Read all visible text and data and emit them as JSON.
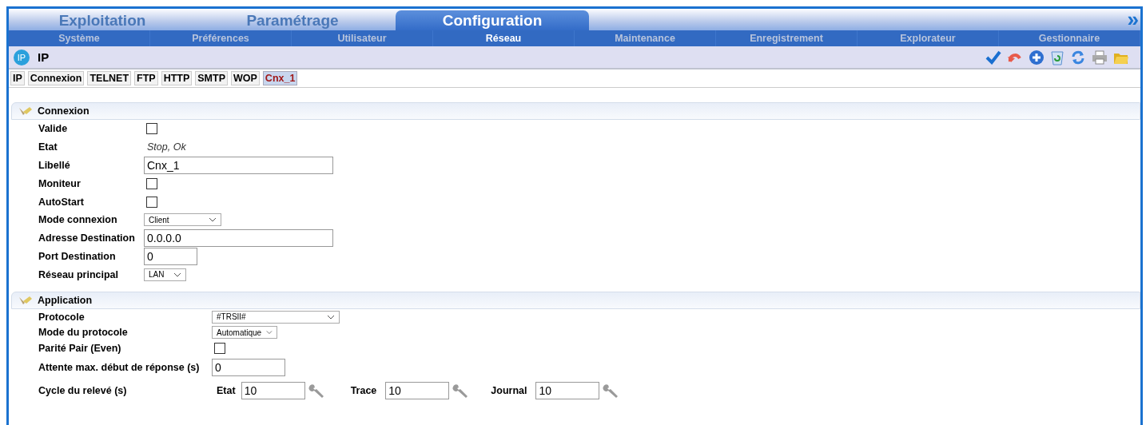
{
  "main_tabs": [
    {
      "label": "Exploitation",
      "selected": false
    },
    {
      "label": "Paramétrage",
      "selected": false
    },
    {
      "label": "Configuration",
      "selected": true
    }
  ],
  "more": "»",
  "sub_nav": [
    {
      "label": "Système",
      "selected": false
    },
    {
      "label": "Préférences",
      "selected": false
    },
    {
      "label": "Utilisateur",
      "selected": false
    },
    {
      "label": "Réseau",
      "selected": true
    },
    {
      "label": "Maintenance",
      "selected": false
    },
    {
      "label": "Enregistrement",
      "selected": false
    },
    {
      "label": "Explorateur",
      "selected": false
    },
    {
      "label": "Gestionnaire",
      "selected": false
    }
  ],
  "page": {
    "badge": "IP",
    "title": "IP"
  },
  "sub_tabs": [
    {
      "label": "IP",
      "selected": false
    },
    {
      "label": "Connexion",
      "selected": false
    },
    {
      "label": "TELNET",
      "selected": false
    },
    {
      "label": "FTP",
      "selected": false
    },
    {
      "label": "HTTP",
      "selected": false
    },
    {
      "label": "SMTP",
      "selected": false
    },
    {
      "label": "WOP",
      "selected": false
    },
    {
      "label": "Cnx_1",
      "selected": true
    }
  ],
  "sections": [
    {
      "title": "Connexion",
      "fields": [
        {
          "kind": "checkbox",
          "label": "Valide",
          "checked": false
        },
        {
          "kind": "text",
          "label": "Etat",
          "value": "Stop, Ok"
        },
        {
          "kind": "input",
          "label": "Libellé",
          "value": "Cnx_1"
        },
        {
          "kind": "checkbox",
          "label": "Moniteur",
          "checked": false
        },
        {
          "kind": "checkbox",
          "label": "AutoStart",
          "checked": false
        },
        {
          "kind": "select",
          "label": "Mode connexion",
          "value": "Client"
        },
        {
          "kind": "input",
          "label": "Adresse Destination",
          "value": "0.0.0.0"
        },
        {
          "kind": "input",
          "label": "Port Destination",
          "value": "0"
        },
        {
          "kind": "select",
          "label": "Réseau principal",
          "value": "LAN"
        }
      ]
    },
    {
      "title": "Application",
      "fields": [
        {
          "kind": "select",
          "label": "Protocole",
          "value": "#TRSII#"
        },
        {
          "kind": "select",
          "label": "Mode du protocole",
          "value": "Automatique"
        },
        {
          "kind": "checkbox",
          "label": "Parité Pair (Even)",
          "checked": false
        },
        {
          "kind": "input",
          "label": "Attente max. début de réponse (s)",
          "value": "0"
        },
        {
          "kind": "cycle",
          "label": "Cycle du relevé (s)",
          "parts": [
            {
              "label": "Etat",
              "value": "10"
            },
            {
              "label": "Trace",
              "value": "10"
            },
            {
              "label": "Journal",
              "value": "10"
            }
          ]
        }
      ]
    }
  ]
}
